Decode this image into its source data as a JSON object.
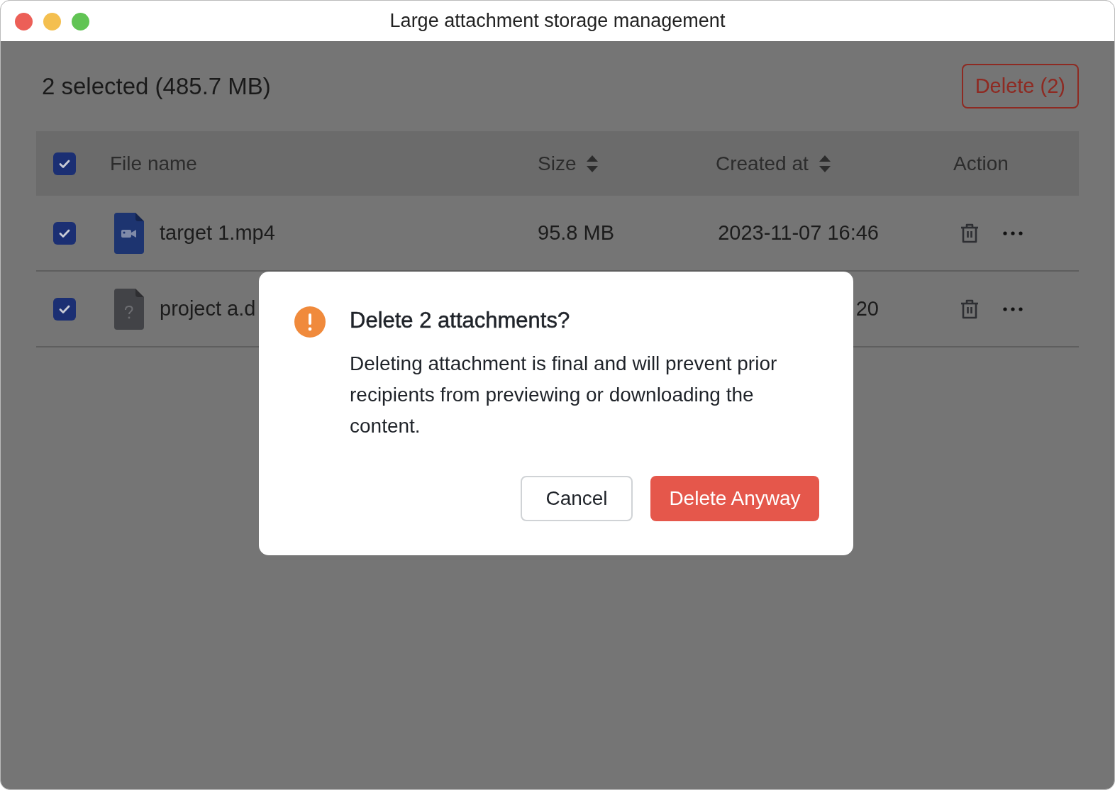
{
  "window": {
    "title": "Large attachment storage management"
  },
  "selection_summary": "2 selected (485.7 MB)",
  "delete_button": "Delete (2)",
  "table": {
    "select_all_checked": true,
    "columns": [
      {
        "label": "File name",
        "sortable": false
      },
      {
        "label": "Size",
        "sortable": true
      },
      {
        "label": "Created at",
        "sortable": true
      },
      {
        "label": "Action",
        "sortable": false
      }
    ],
    "rows": [
      {
        "checked": true,
        "kind": "video",
        "name": "target 1.mp4",
        "size": "95.8 MB",
        "created_at": "2023-11-07 16:46"
      },
      {
        "checked": true,
        "kind": "unknown",
        "name": "project a.d",
        "created_at": "20"
      }
    ]
  },
  "dialog": {
    "title": "Delete 2 attachments?",
    "message": "Deleting attachment is final and will prevent prior recipients from previewing or downloading the content.",
    "buttons": [
      {
        "label": "Cancel",
        "kind": "secondary"
      },
      {
        "label": "Delete Anyway",
        "kind": "primary"
      }
    ]
  }
}
